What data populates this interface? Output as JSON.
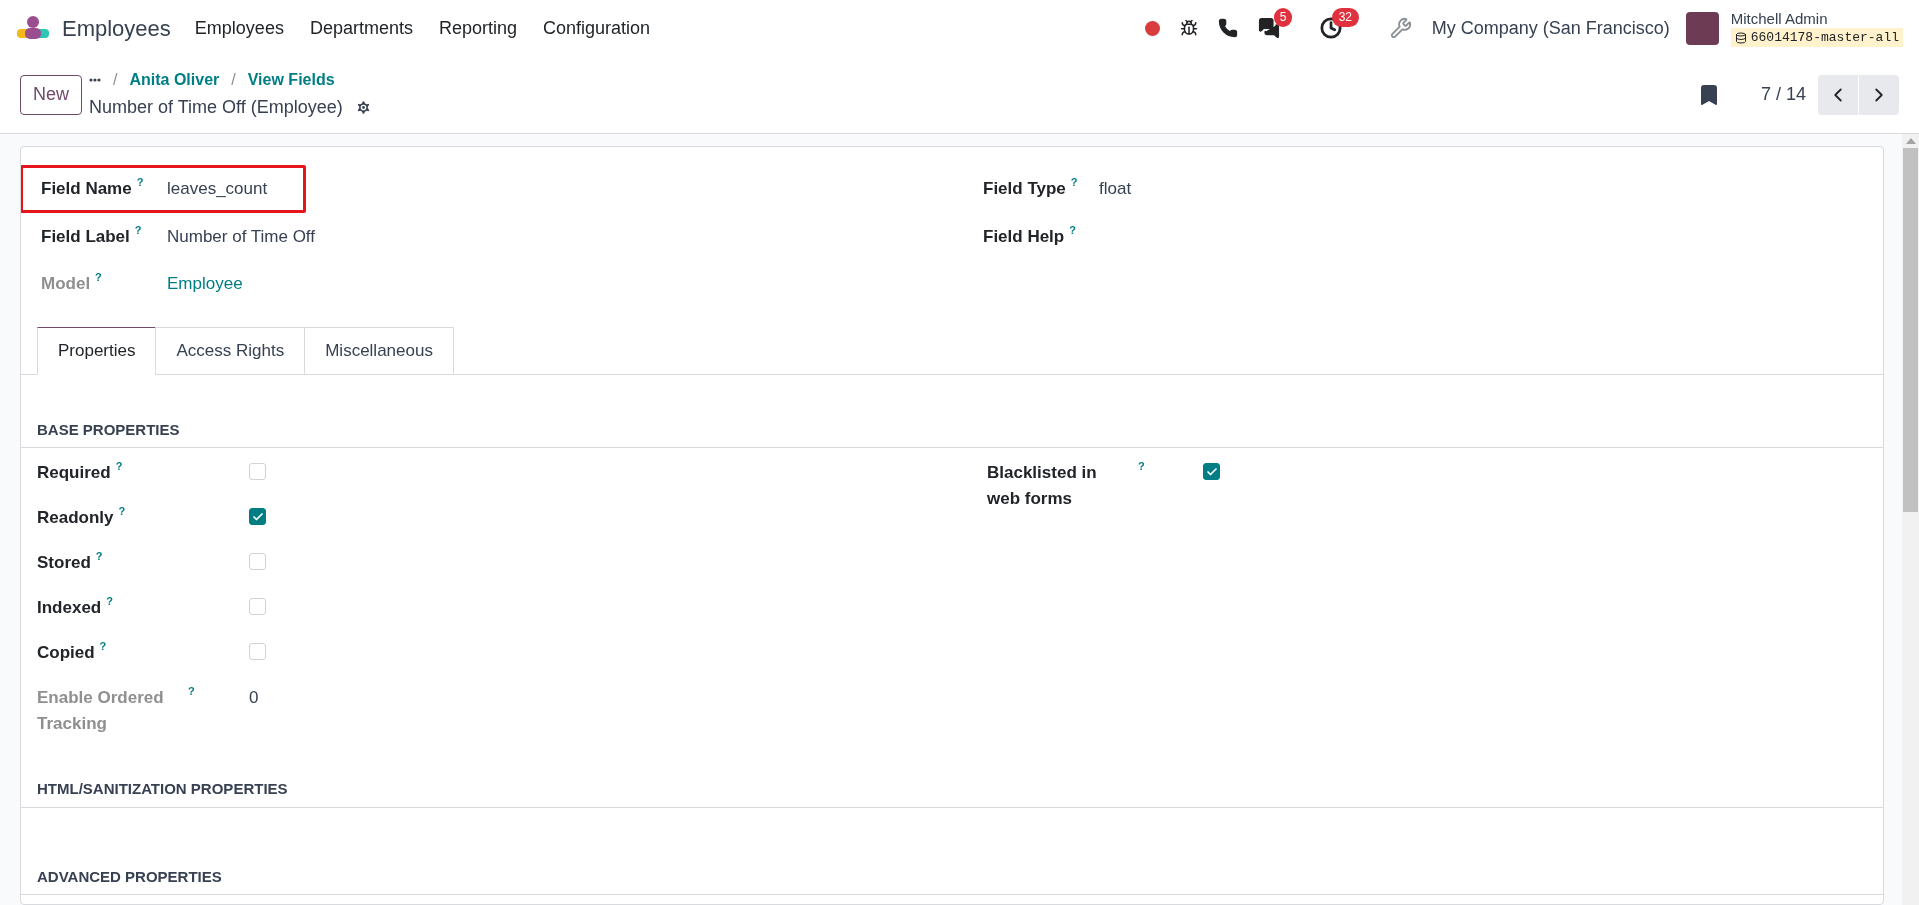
{
  "navbar": {
    "app_name": "Employees",
    "menu": [
      "Employees",
      "Departments",
      "Reporting",
      "Configuration"
    ],
    "messages_badge": "5",
    "activities_badge": "32",
    "company": "My Company (San Francisco)",
    "user_name": "Mitchell Admin",
    "database": "66014178-master-all"
  },
  "control_panel": {
    "new_button": "New",
    "breadcrumbs": [
      {
        "separator": "/",
        "label": "Anita Oliver"
      },
      {
        "separator": "/",
        "label": "View Fields"
      }
    ],
    "record_title": "Number of Time Off (Employee)",
    "pager": "7 / 14"
  },
  "header_fields": {
    "left": [
      {
        "label": "Field Name",
        "help": "?",
        "value": "leaves_count",
        "kind": "text",
        "muted": false,
        "highlighted": true
      },
      {
        "label": "Field Label",
        "help": "?",
        "value": "Number of Time Off",
        "kind": "text",
        "muted": false
      },
      {
        "label": "Model",
        "help": "?",
        "value": "Employee",
        "kind": "link",
        "muted": true
      }
    ],
    "right": [
      {
        "label": "Field Type",
        "help": "?",
        "value": "float",
        "kind": "text",
        "muted": false
      },
      {
        "label": "Field Help",
        "help": "?",
        "muted": false
      }
    ]
  },
  "tabs": [
    {
      "label": "Properties",
      "selected": true
    },
    {
      "label": "Access Rights",
      "selected": false
    },
    {
      "label": "Miscellaneous",
      "selected": false
    }
  ],
  "sections": [
    {
      "title": "BASE PROPERTIES",
      "left": [
        {
          "label": "Required",
          "help": "?",
          "kind": "checkbox",
          "checked": false,
          "muted": false
        },
        {
          "label": "Readonly",
          "help": "?",
          "kind": "checkbox",
          "checked": true,
          "muted": false
        },
        {
          "label": "Stored",
          "help": "?",
          "kind": "checkbox",
          "checked": false,
          "muted": false
        },
        {
          "label": "Indexed",
          "help": "?",
          "kind": "checkbox",
          "checked": false,
          "muted": false
        },
        {
          "label": "Copied",
          "help": "?",
          "kind": "checkbox",
          "checked": false,
          "muted": false
        },
        {
          "label": "Enable Ordered Tracking",
          "help": "?",
          "kind": "value",
          "value": "0",
          "muted": true
        }
      ],
      "right": [
        {
          "label": "Blacklisted in web forms",
          "help": "?",
          "kind": "checkbox",
          "checked": true,
          "muted": false
        }
      ]
    },
    {
      "title": "HTML/SANITIZATION PROPERTIES"
    },
    {
      "title": "ADVANCED PROPERTIES"
    }
  ]
}
